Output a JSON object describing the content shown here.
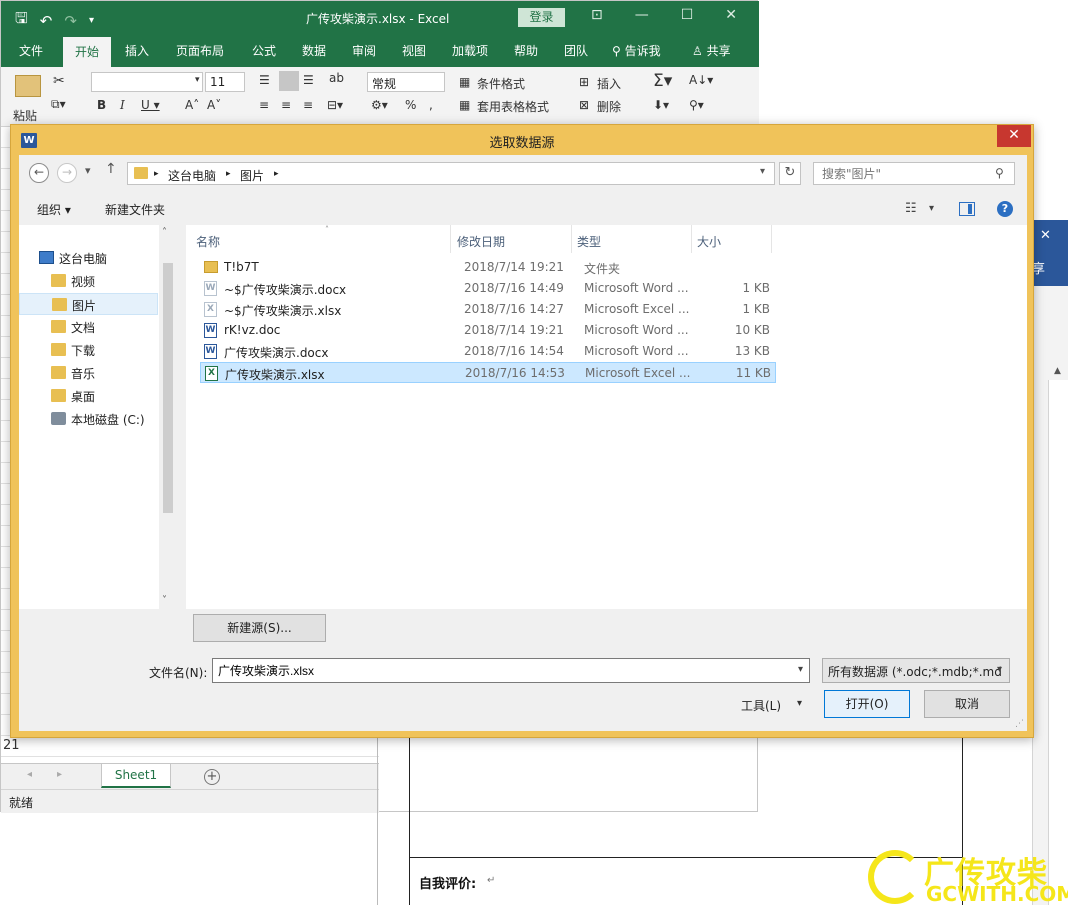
{
  "excel": {
    "title": "广传攻柴演示.xlsx  -  Excel",
    "login_label": "登录",
    "tabs": [
      "文件",
      "开始",
      "插入",
      "页面布局",
      "公式",
      "数据",
      "审阅",
      "视图",
      "加载项",
      "帮助",
      "团队"
    ],
    "tell_me": "告诉我",
    "share": "共享",
    "ribbon": {
      "paste": "粘贴",
      "font_size": "11",
      "number_format": "常规",
      "conditional_format": "条件格式",
      "table_format": "套用表格格式",
      "insert": "插入",
      "delete": "删除"
    },
    "row_21": "21",
    "sheet_tab": "Sheet1",
    "status": "就绪"
  },
  "word": {
    "share_partial": "享",
    "self_eval": "自我评价:",
    "para_mark": "↵"
  },
  "watermark": {
    "cn": "广传攻柴",
    "en": "GCWITH.COM"
  },
  "dialog": {
    "title": "选取数据源",
    "close": "✕",
    "breadcrumb": [
      "这台电脑",
      "图片"
    ],
    "search_placeholder": "搜索\"图片\"",
    "organize": "组织 ▾",
    "new_folder": "新建文件夹",
    "nav_tree": [
      {
        "label": "这台电脑",
        "icon": "computer-icon",
        "indent": 0,
        "selected": false
      },
      {
        "label": "视频",
        "icon": "video-folder-icon",
        "indent": 1,
        "selected": false
      },
      {
        "label": "图片",
        "icon": "pictures-folder-icon",
        "indent": 1,
        "selected": true
      },
      {
        "label": "文档",
        "icon": "documents-folder-icon",
        "indent": 1,
        "selected": false
      },
      {
        "label": "下载",
        "icon": "downloads-folder-icon",
        "indent": 1,
        "selected": false
      },
      {
        "label": "音乐",
        "icon": "music-folder-icon",
        "indent": 1,
        "selected": false
      },
      {
        "label": "桌面",
        "icon": "desktop-folder-icon",
        "indent": 1,
        "selected": false
      },
      {
        "label": "本地磁盘 (C:)",
        "icon": "disk-icon",
        "indent": 1,
        "selected": false
      }
    ],
    "columns": {
      "name": "名称",
      "date": "修改日期",
      "type": "类型",
      "size": "大小"
    },
    "files": [
      {
        "name": "T!b7T",
        "date": "2018/7/14 19:21",
        "type": "文件夹",
        "size": "",
        "kind": "folder",
        "selected": false
      },
      {
        "name": "~$广传攻柴演示.docx",
        "date": "2018/7/16 14:49",
        "type": "Microsoft Word ...",
        "size": "1 KB",
        "kind": "temp",
        "selected": false
      },
      {
        "name": "~$广传攻柴演示.xlsx",
        "date": "2018/7/16 14:27",
        "type": "Microsoft Excel ...",
        "size": "1 KB",
        "kind": "temp",
        "selected": false
      },
      {
        "name": "rK!vz.doc",
        "date": "2018/7/14 19:21",
        "type": "Microsoft Word ...",
        "size": "10 KB",
        "kind": "word",
        "selected": false
      },
      {
        "name": "广传攻柴演示.docx",
        "date": "2018/7/16 14:54",
        "type": "Microsoft Word ...",
        "size": "13 KB",
        "kind": "word",
        "selected": false
      },
      {
        "name": "广传攻柴演示.xlsx",
        "date": "2018/7/16 14:53",
        "type": "Microsoft Excel ...",
        "size": "11 KB",
        "kind": "excel",
        "selected": true
      }
    ],
    "new_source": "新建源(S)...",
    "filename_label": "文件名(N):",
    "filename_value": "广传攻柴演示.xlsx",
    "filter_value": "所有数据源 (*.odc;*.mdb;*.md",
    "tools": "工具(L)",
    "open": "打开(O)",
    "cancel": "取消"
  }
}
